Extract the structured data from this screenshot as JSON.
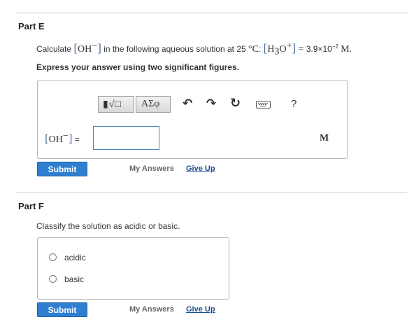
{
  "part_e": {
    "title": "Part E",
    "question": {
      "prefix": "Calculate",
      "oh": "OH",
      "oh_charge": "−",
      "mid": "in the following aqueous solution at 25",
      "temp_unit": "°C",
      "colon": ":",
      "h3o_h": "H",
      "h3o_3": "3",
      "h3o_o": "O",
      "h3o_charge": "+",
      "equals": "=",
      "value": "3.9×10",
      "exponent": "−2",
      "unit": "M",
      "period": "."
    },
    "instruction": "Express your answer using two significant figures.",
    "toolbar": {
      "template_glyph": "▮√□",
      "greek_label": "ΑΣφ",
      "undo_glyph": "↶",
      "redo_glyph": "↷",
      "reset_glyph": "↻",
      "help_label": "?"
    },
    "answer_label_oh": "OH",
    "answer_label_charge": "−",
    "answer_label_eq": "=",
    "answer_value": "",
    "unit": "M",
    "submit_label": "Submit",
    "my_answers_label": "My Answers",
    "give_up_label": "Give Up"
  },
  "part_f": {
    "title": "Part F",
    "question": "Classify the solution as acidic or basic.",
    "options": [
      "acidic",
      "basic"
    ],
    "submit_label": "Submit",
    "my_answers_label": "My Answers",
    "give_up_label": "Give Up"
  },
  "colors": {
    "accent": "#2f7fd0",
    "link": "#1a4d8f",
    "bracket": "#4a6fa0"
  }
}
